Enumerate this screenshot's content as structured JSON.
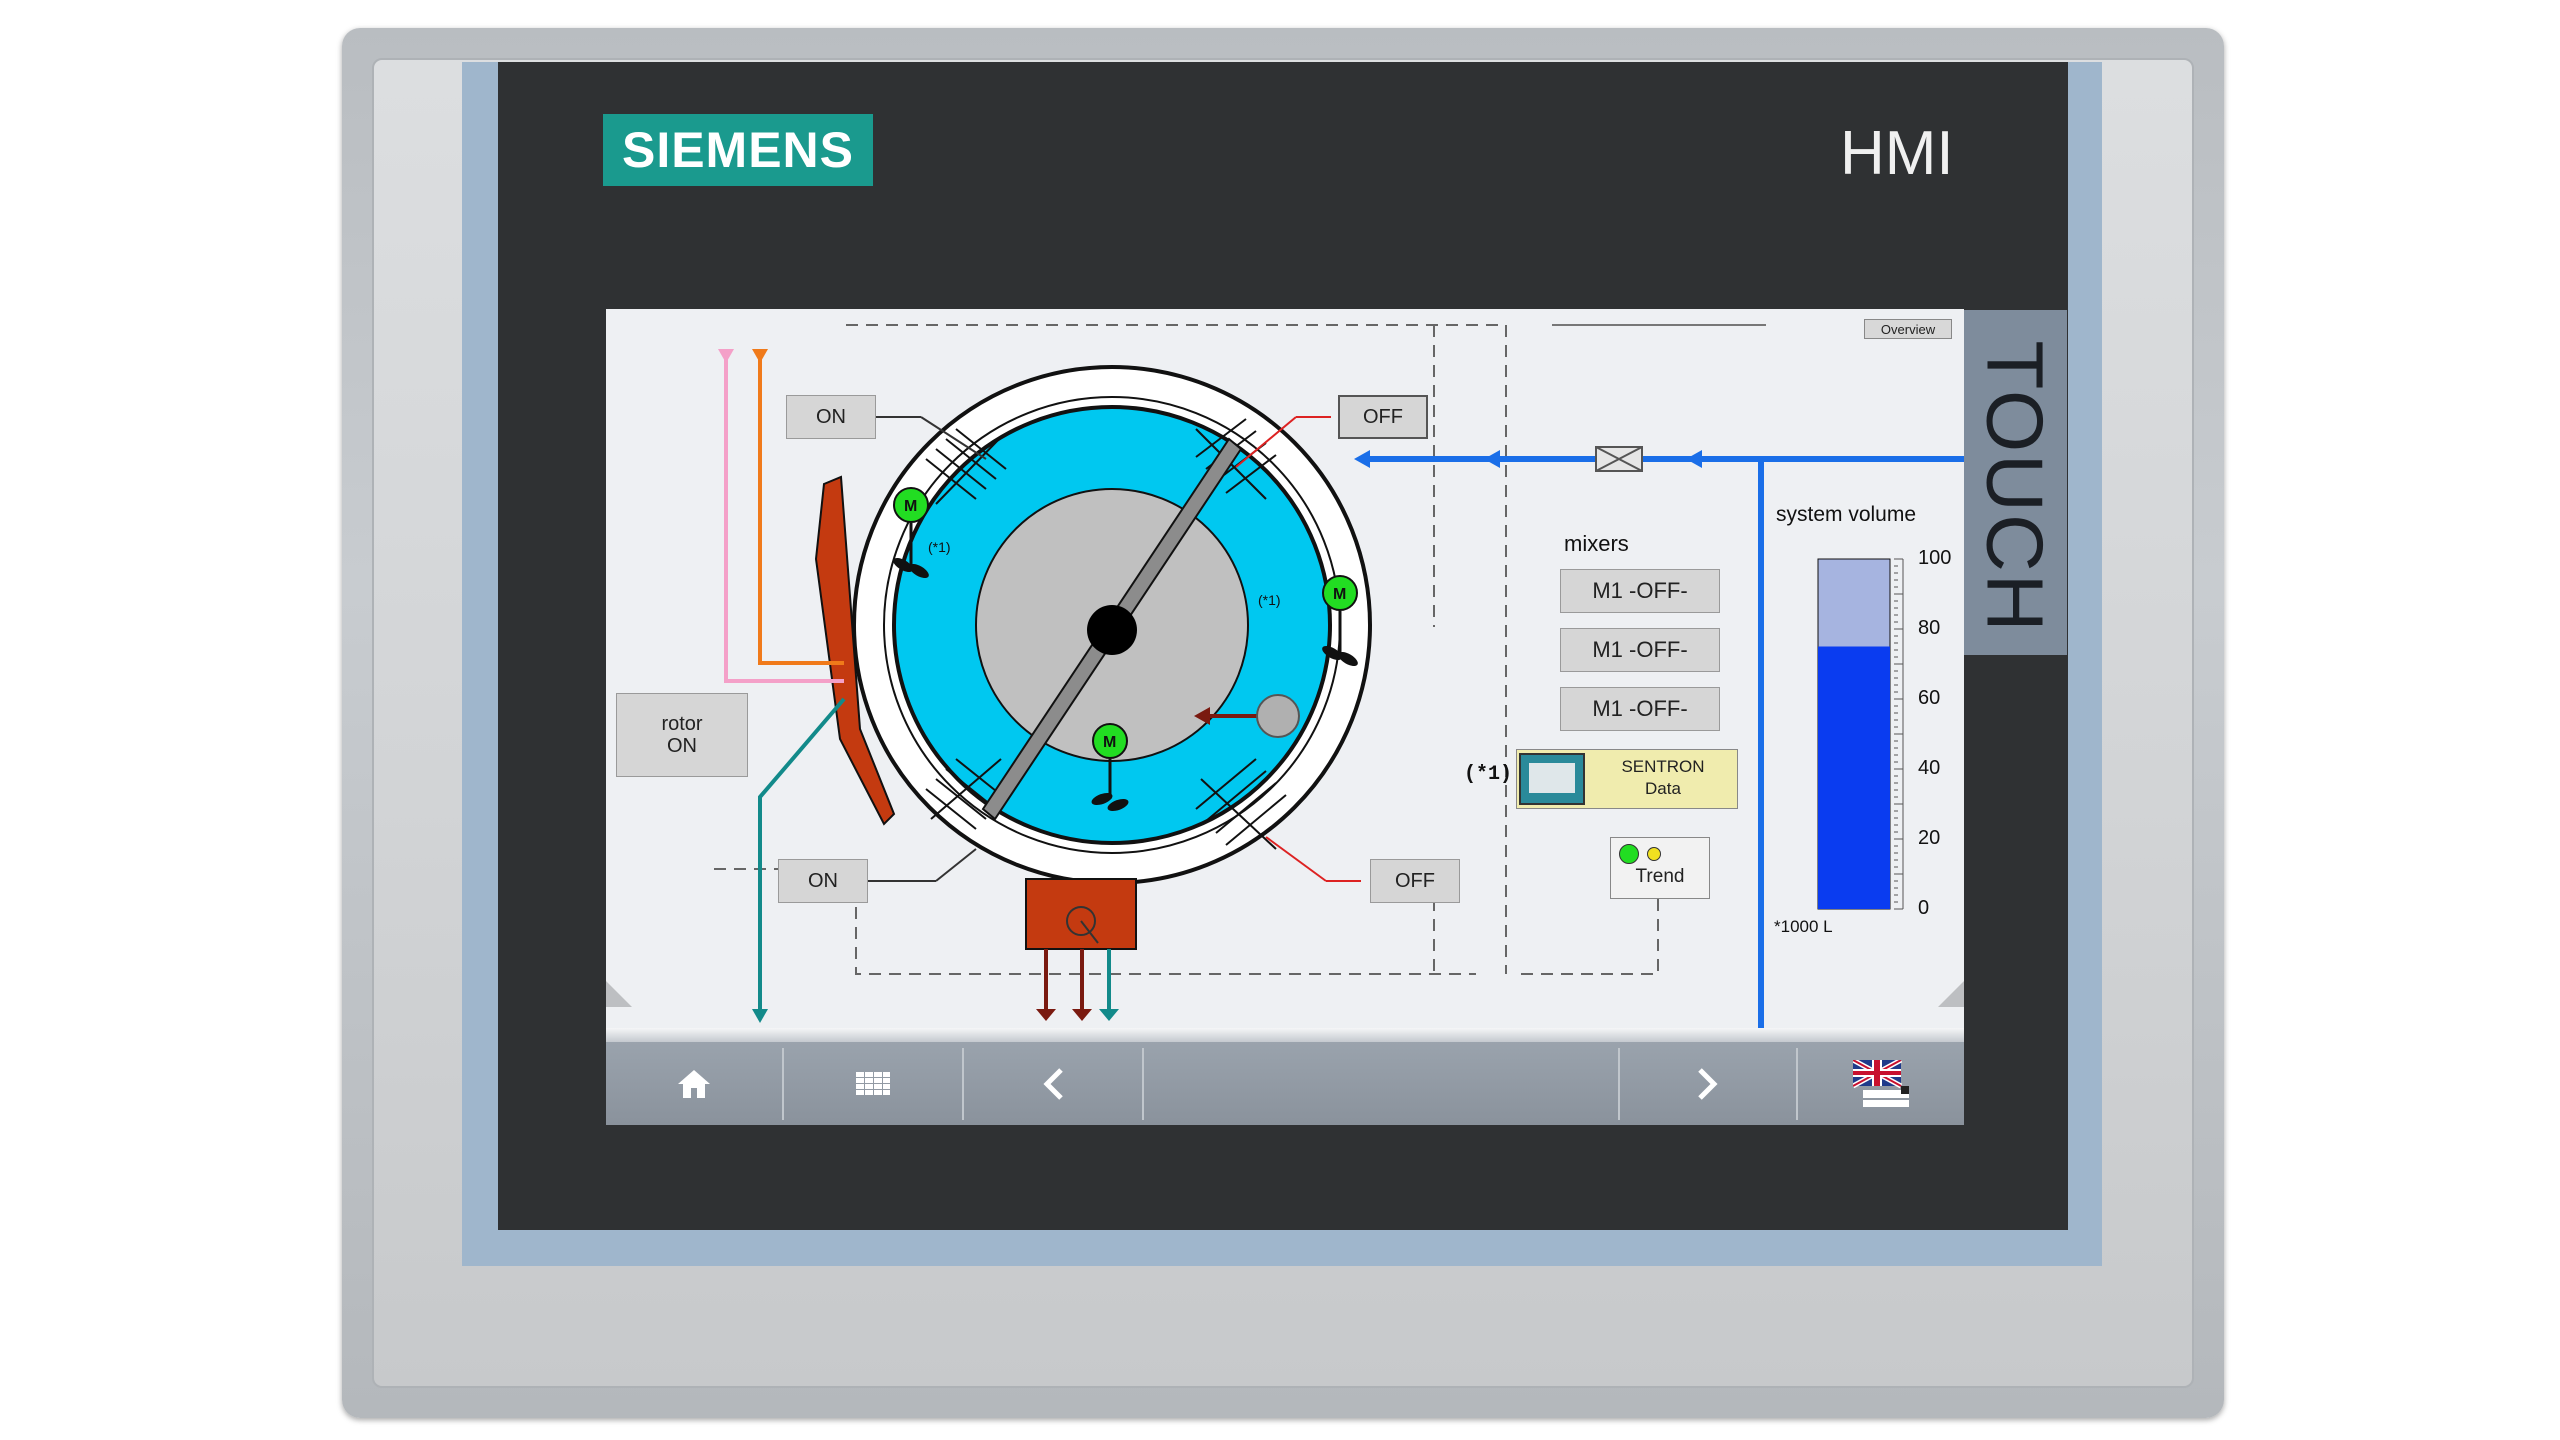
{
  "device": {
    "brand": "SIEMENS",
    "model": "HMI",
    "touch_label": "TOUCH"
  },
  "screen": {
    "overview_button": "Overview",
    "mixer_motor_label": "M",
    "mixer_footnote": "(*1)",
    "buttons": {
      "on_top": "ON",
      "off_top": "OFF",
      "on_bottom": "ON",
      "off_bottom": "OFF",
      "rotor_line1": "rotor",
      "rotor_line2": "ON"
    },
    "mixers": {
      "title": "mixers",
      "items": [
        "M1 -OFF-",
        "M1 -OFF-",
        "M1 -OFF-"
      ]
    },
    "sentron": {
      "footnote": "(*1)",
      "line1": "SENTRON",
      "line2": "Data"
    },
    "trend_label": "Trend",
    "tank": {
      "title": "system volume",
      "ticks": [
        "100",
        "80",
        "60",
        "40",
        "20",
        "0"
      ],
      "unit": "*1000 L",
      "max": 100,
      "level": 75
    },
    "colors": {
      "drum": "#00c8f0",
      "rotor_gray": "#c0c0c0",
      "pipe_blue": "#1a6ee8",
      "pipe_orange": "#f07a1a",
      "pipe_pink": "#f4a0c8",
      "pipe_teal": "#128a8a",
      "motor_green": "#22dd22",
      "heater_red": "#c43a10",
      "tank_fill": "#0a3cf0",
      "tank_empty": "#a6b4e0"
    }
  },
  "navbar": {
    "items": [
      "home-icon",
      "grid-icon",
      "chevron-left-icon",
      "chevron-right-icon",
      "language-flag-icon"
    ]
  }
}
